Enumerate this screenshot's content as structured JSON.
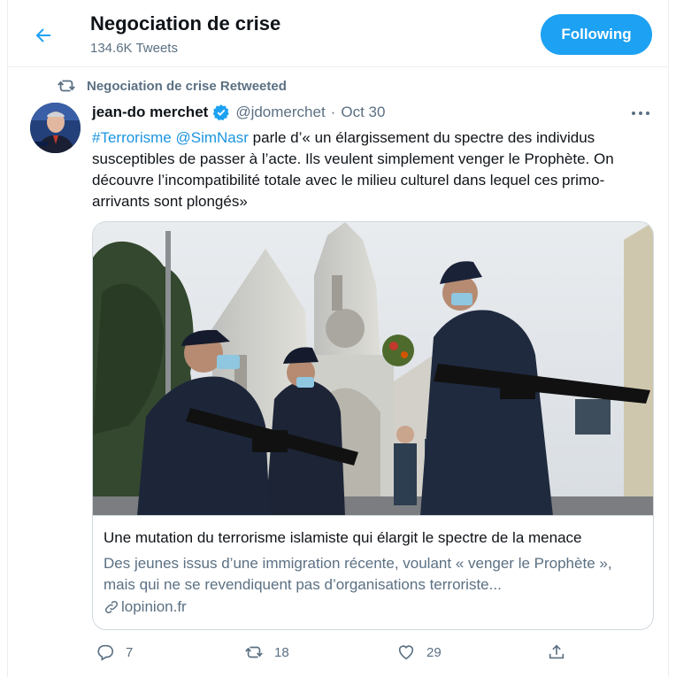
{
  "header": {
    "title": "Negociation de crise",
    "tweet_count": "134.6K Tweets",
    "follow_label": "Following"
  },
  "retweet_notice": "Negociation de crise Retweeted",
  "tweet": {
    "author_name": "jean-do merchet",
    "handle": "@jdomerchet",
    "separator": "·",
    "date": "Oct 30",
    "hashtag": "#Terrorisme",
    "mention": "@SimNasr",
    "body": "parle d’« un élargissement du spectre des individus susceptibles de passer à l’acte. Ils veulent simplement venger le Prophète. On découvre l’incompatibilité totale avec le milieu culturel dans lequel ces primo-arrivants sont plongés»"
  },
  "card": {
    "title": "Une mutation du terrorisme islamiste qui élargit le spectre de la menace",
    "description": "Des jeunes issus d’une immigration récente, voulant « venger le Prophète », mais qui ne se revendiquent pas d’organisations terroriste...",
    "domain": "lopinion.fr"
  },
  "actions": {
    "reply_count": "7",
    "retweet_count": "18",
    "like_count": "29"
  },
  "colors": {
    "accent": "#1da1f2",
    "link": "#1b95e0",
    "secondary_text": "#5b7083",
    "border": "#cfd9de"
  },
  "icons": [
    "back-arrow-icon",
    "retweet-icon",
    "verified-badge-icon",
    "more-icon",
    "link-icon",
    "reply-icon",
    "like-icon",
    "share-icon"
  ]
}
